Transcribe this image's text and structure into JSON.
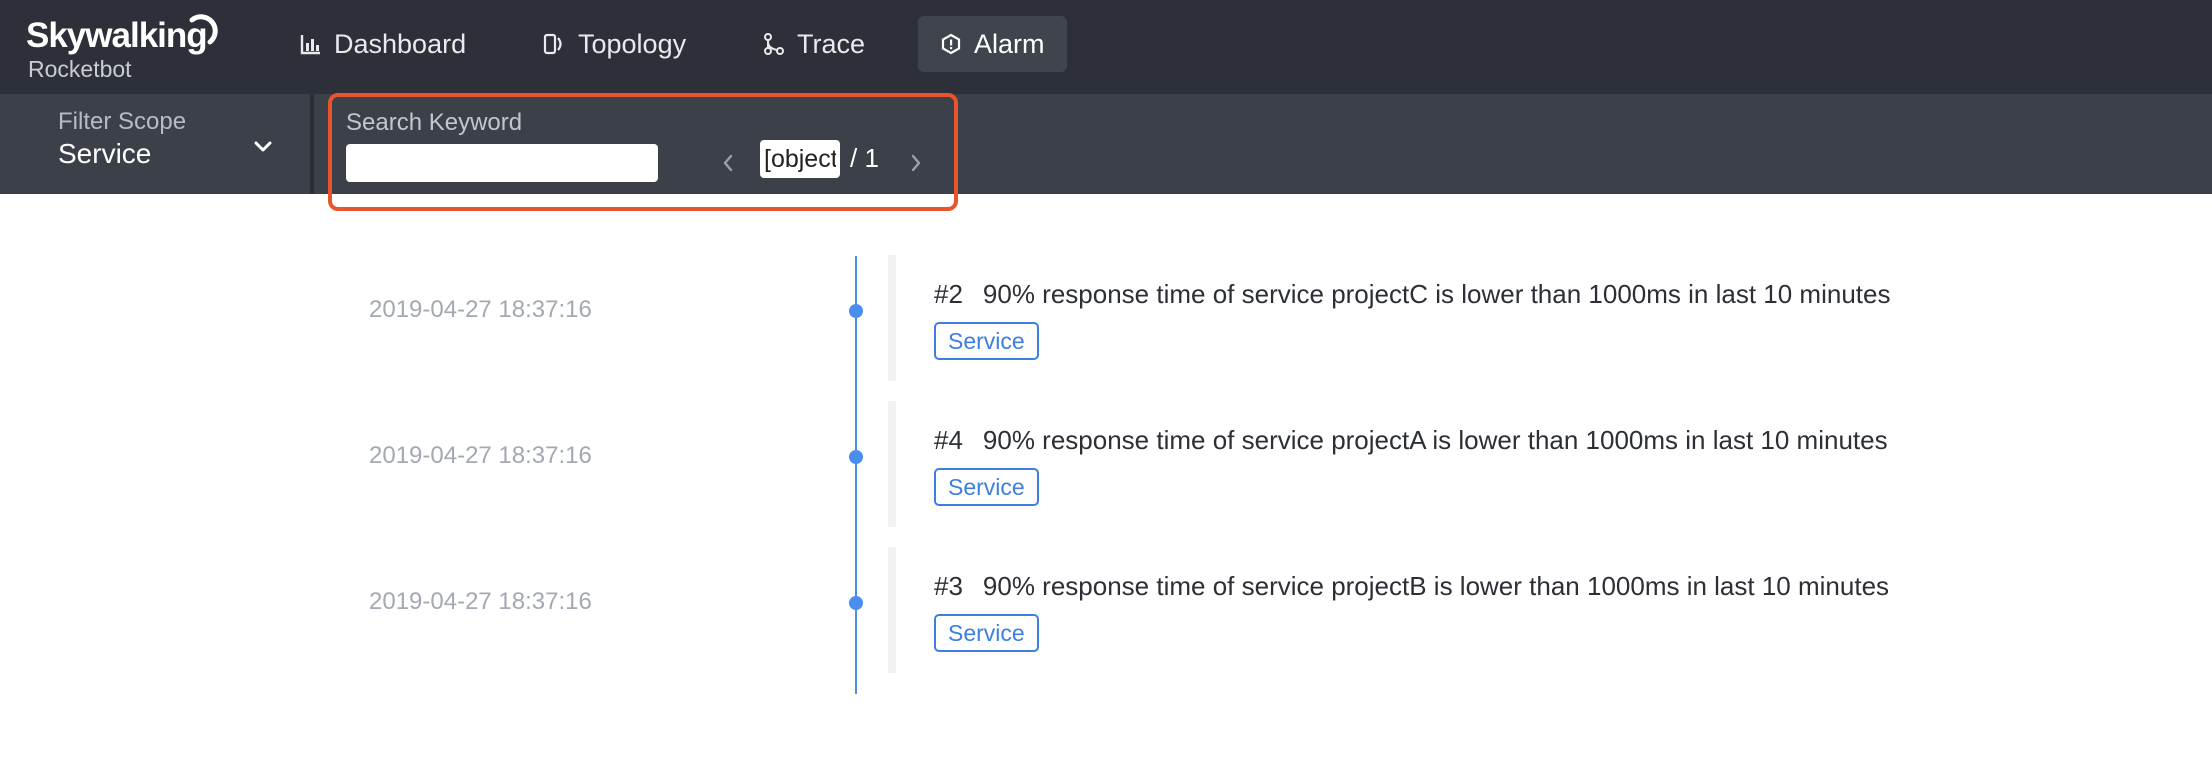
{
  "brand": {
    "title": "Skywalking",
    "subtitle": "Rocketbot"
  },
  "nav": {
    "items": [
      {
        "id": "dashboard",
        "label": "Dashboard",
        "icon": "bar-chart-icon",
        "active": false
      },
      {
        "id": "topology",
        "label": "Topology",
        "icon": "topology-icon",
        "active": false
      },
      {
        "id": "trace",
        "label": "Trace",
        "icon": "trace-icon",
        "active": false
      },
      {
        "id": "alarm",
        "label": "Alarm",
        "icon": "alarm-icon",
        "active": true
      }
    ]
  },
  "filter": {
    "scope_label": "Filter Scope",
    "scope_value": "Service",
    "search_label": "Search Keyword",
    "search_value": "",
    "page_current": "[object Object]",
    "page_total": "/ 1"
  },
  "alarms": [
    {
      "time": "2019-04-27 18:37:16",
      "id": "#2",
      "message": "90% response time of service projectC is lower than 1000ms in last 10 minutes",
      "tag": "Service"
    },
    {
      "time": "2019-04-27 18:37:16",
      "id": "#4",
      "message": "90% response time of service projectA is lower than 1000ms in last 10 minutes",
      "tag": "Service"
    },
    {
      "time": "2019-04-27 18:37:16",
      "id": "#3",
      "message": "90% response time of service projectB is lower than 1000ms in last 10 minutes",
      "tag": "Service"
    }
  ],
  "colors": {
    "topbar": "#2d3038",
    "toolbar": "#3c4049",
    "accent": "#4a8ef0",
    "highlight": "#e8542b"
  }
}
